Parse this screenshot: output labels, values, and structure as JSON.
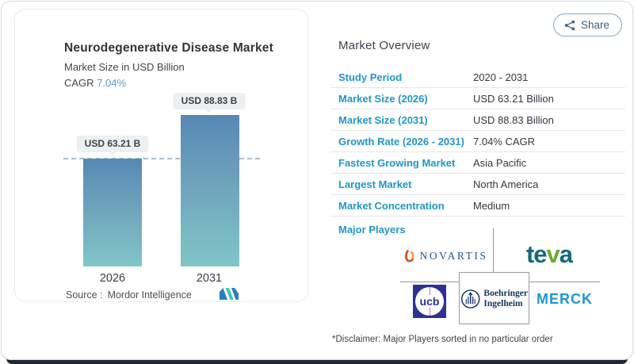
{
  "chart_data": {
    "type": "bar",
    "title": "Neurodegenerative Disease Market",
    "subtitle": "Market Size in USD Billion",
    "cagr_label": "CAGR",
    "cagr_value": "7.04%",
    "categories": [
      "2026",
      "2031"
    ],
    "values": [
      63.21,
      88.83
    ],
    "unit": "USD Billion",
    "bar_labels": [
      "USD 63.21 B",
      "USD 88.83 B"
    ],
    "dashed_reference_value": 63.21,
    "ylim": [
      0,
      100
    ],
    "legend": "none",
    "grid": "off",
    "source_label": "Source :",
    "source_value": "Mordor Intelligence"
  },
  "share": {
    "label": "Share"
  },
  "overview": {
    "title": "Market Overview",
    "rows": [
      {
        "label": "Study Period",
        "value": "2020 - 2031"
      },
      {
        "label": "Market Size (2026)",
        "value": "USD 63.21 Billion"
      },
      {
        "label": "Market Size (2031)",
        "value": "USD 88.83 Billion"
      },
      {
        "label": "Growth Rate (2026 - 2031)",
        "value": "7.04% CAGR"
      },
      {
        "label": "Fastest Growing Market",
        "value": "Asia Pacific"
      },
      {
        "label": "Largest Market",
        "value": "North America"
      },
      {
        "label": "Market Concentration",
        "value": "Medium"
      }
    ],
    "major_players_label": "Major Players",
    "players": [
      "Novartis",
      "Teva",
      "UCB",
      "Boehringer Ingelheim",
      "Merck"
    ],
    "disclaimer": "*Disclaimer: Major Players sorted in no particular order"
  },
  "logos": {
    "novartis": "NOVARTIS",
    "teva": {
      "p1": "te",
      "p2": "v",
      "p3": "a"
    },
    "ucb": "ucb",
    "boehringer_line1": "Boehringer",
    "boehringer_line2": "Ingelheim",
    "merck": "MERCK"
  },
  "colors": {
    "label_blue": "#2196c9",
    "cagr_blue": "#5d9bce",
    "bar_gradient_top": "#5789b4",
    "bar_gradient_bottom": "#81c6c7",
    "dark_footer": "#1e2a38",
    "share_text": "#3c627e",
    "divider": "#e6e8eb"
  }
}
